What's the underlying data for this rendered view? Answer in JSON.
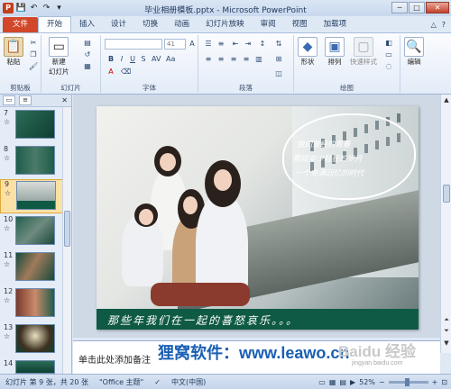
{
  "window": {
    "title": "毕业相册模板.pptx - Microsoft PowerPoint",
    "controls": [
      "─",
      "□",
      "✕"
    ]
  },
  "qat": {
    "items": [
      "P",
      "save",
      "undo",
      "redo",
      "dropdown"
    ]
  },
  "ribbon_tabs": [
    {
      "label": "文件"
    },
    {
      "label": "开始"
    },
    {
      "label": "插入"
    },
    {
      "label": "设计"
    },
    {
      "label": "切换"
    },
    {
      "label": "动画"
    },
    {
      "label": "幻灯片放映"
    },
    {
      "label": "审阅"
    },
    {
      "label": "视图"
    },
    {
      "label": "加载项"
    }
  ],
  "ribbon": {
    "clipboard": {
      "paste_label": "粘贴",
      "group_label": "剪贴板"
    },
    "slides": {
      "new_slide_label": "新建",
      "new_slide_label2": "幻灯片",
      "group_label": "幻灯片"
    },
    "font": {
      "size_value": "41",
      "group_label": "字体"
    },
    "paragraph": {
      "group_label": "段落"
    },
    "drawing": {
      "shape_label": "形状",
      "arrange_label": "排列",
      "quickstyle_label": "快速样式",
      "group_label": "绘图"
    },
    "editing": {
      "edit_label": "编辑"
    }
  },
  "thumbnails": [
    {
      "num": "7",
      "mark": "☆"
    },
    {
      "num": "8",
      "mark": "☆"
    },
    {
      "num": "9",
      "mark": "☆"
    },
    {
      "num": "10",
      "mark": "☆"
    },
    {
      "num": "11",
      "mark": "☆"
    },
    {
      "num": "12",
      "mark": "☆"
    },
    {
      "num": "13",
      "mark": "☆"
    },
    {
      "num": "14",
      "mark": ""
    }
  ],
  "slide": {
    "cloud_lines": [
      "我们曾经的青春",
      "那段年少轻狂的岁月",
      "一个充满回忆的时代"
    ],
    "caption": "那些年我们在一起的喜怒哀乐。。。"
  },
  "notes": {
    "placeholder": "单击此处添加备注",
    "watermark": "狸窝软件：www.leawo.cn",
    "logo": "Baidu 经验",
    "logo_url": "jingyan.baidu.com"
  },
  "statusbar": {
    "slide_info": "幻灯片 第 9 张，共 20 张",
    "theme": "\"Office 主题\"",
    "language": "中文(中国)",
    "zoom": "52%"
  },
  "colors": {
    "file_tab": "#d2472a",
    "caption_bar": "#0f5a44",
    "selected_thumb": "#fbe1a5"
  }
}
